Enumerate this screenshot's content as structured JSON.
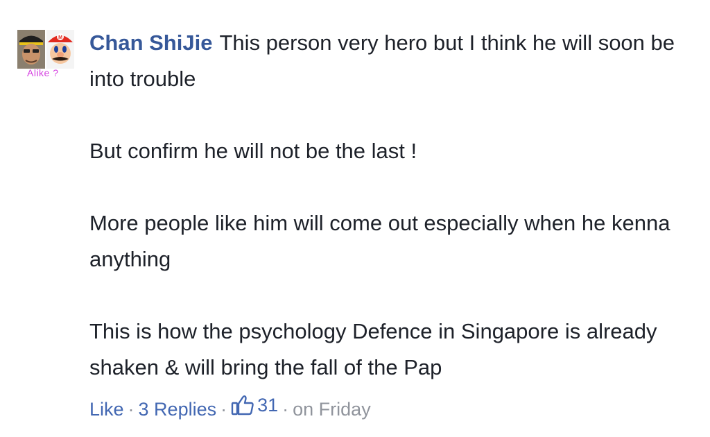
{
  "comment": {
    "author": "Chan ShiJie",
    "avatar_caption": "Alike ?",
    "paragraphs": [
      "This person very hero but I think he will soon be into trouble",
      "But confirm he will not be the last !",
      "More people like him will come out especially when he kenna anything",
      "This is how the psychology Defence in Singapore is already shaken & will bring the fall of the Pap"
    ],
    "actions": {
      "like_label": "Like",
      "separator": "·",
      "replies_label": "3 Replies",
      "like_count": "31",
      "timestamp": "on Friday"
    }
  },
  "icons": {
    "like_count_icon": "thumbs-up-icon"
  },
  "colors": {
    "author": "#365899",
    "link": "#4267b2",
    "meta": "#90949c",
    "text": "#1d2129",
    "caption": "#d43fe0"
  }
}
